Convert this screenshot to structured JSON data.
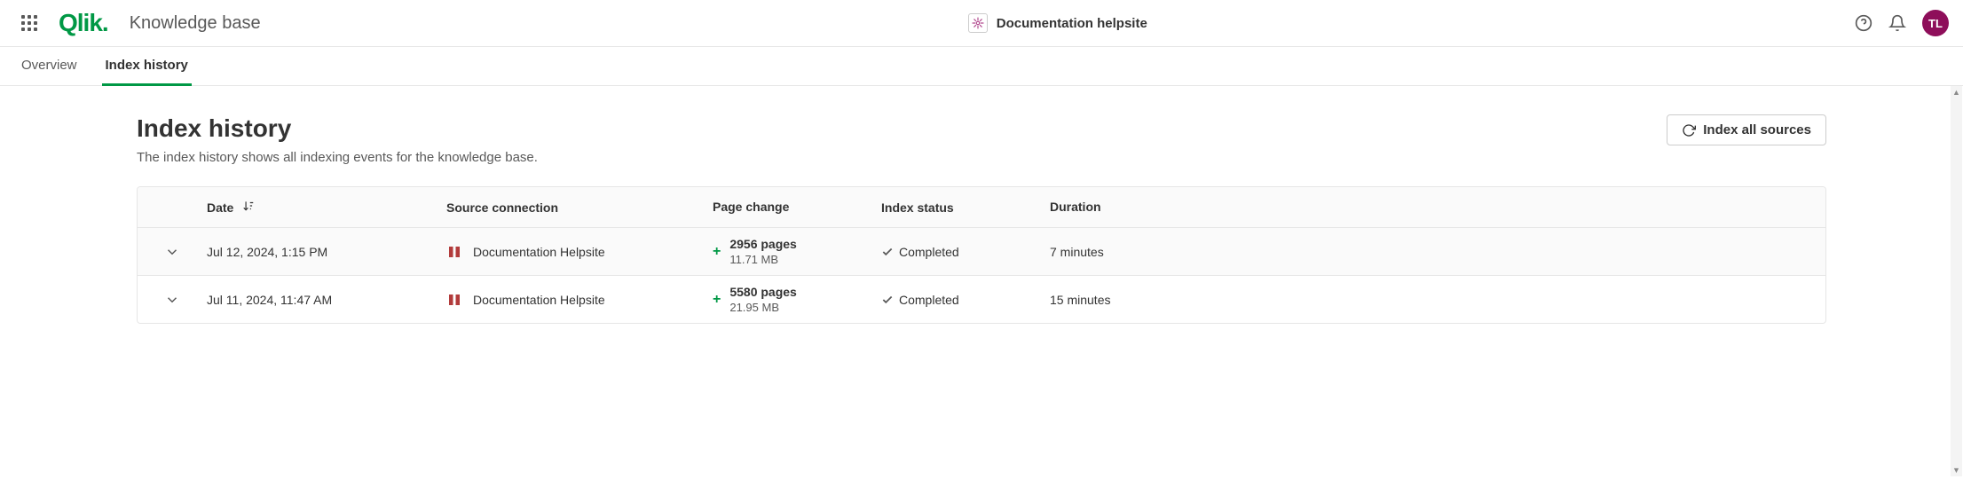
{
  "header": {
    "logo_text": "Qlik.",
    "app_title": "Knowledge base",
    "source_label": "Documentation helpsite",
    "avatar_initials": "TL"
  },
  "tabs": [
    {
      "label": "Overview",
      "active": false
    },
    {
      "label": "Index history",
      "active": true
    }
  ],
  "page": {
    "title": "Index history",
    "description": "The index history shows all indexing events for the knowledge base.",
    "index_button": "Index all sources"
  },
  "table": {
    "columns": {
      "date": "Date",
      "source": "Source connection",
      "page_change": "Page change",
      "status": "Index status",
      "duration": "Duration"
    },
    "rows": [
      {
        "date": "Jul 12, 2024, 1:15 PM",
        "source": "Documentation Helpsite",
        "pages": "2956 pages",
        "size": "11.71 MB",
        "status": "Completed",
        "duration": "7 minutes"
      },
      {
        "date": "Jul 11, 2024, 11:47 AM",
        "source": "Documentation Helpsite",
        "pages": "5580 pages",
        "size": "21.95 MB",
        "status": "Completed",
        "duration": "15 minutes"
      }
    ]
  }
}
